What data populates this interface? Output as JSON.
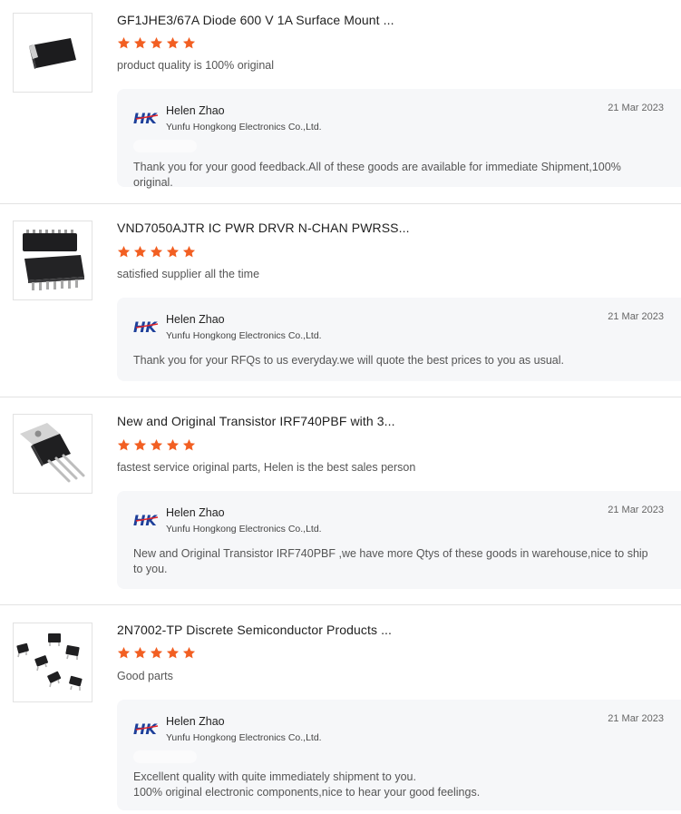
{
  "reviews": [
    {
      "product": "GF1JHE3/67A Diode 600 V 1A Surface Mount ...",
      "rating": 5,
      "comment": "product quality is 100% original",
      "thumbnail_icon": "smd-diode-icon",
      "reply": {
        "name": "Helen Zhao",
        "company": "Yunfu Hongkong Electronics Co.,Ltd.",
        "date": "21 Mar 2023",
        "text": "Thank you for your good feedback.All of these goods are available for immediate Shipment,100% original."
      }
    },
    {
      "product": "VND7050AJTR IC PWR DRVR N-CHAN PWRSS...",
      "rating": 5,
      "comment": "satisfied supplier all the time",
      "thumbnail_icon": "power-ic-icon",
      "reply": {
        "name": "Helen Zhao",
        "company": "Yunfu Hongkong Electronics Co.,Ltd.",
        "date": "21 Mar 2023",
        "text": "Thank you for your RFQs to us everyday.we will quote the best prices to you as usual."
      }
    },
    {
      "product": "New and Original Transistor IRF740PBF with 3...",
      "rating": 5,
      "comment": "fastest service original parts, Helen is the best sales person",
      "thumbnail_icon": "to220-transistor-icon",
      "reply": {
        "name": "Helen Zhao",
        "company": "Yunfu Hongkong Electronics Co.,Ltd.",
        "date": "21 Mar 2023",
        "text": "New and Original Transistor IRF740PBF ,we have more Qtys of these goods in warehouse,nice to ship to you."
      }
    },
    {
      "product": "2N7002-TP Discrete Semiconductor Products ...",
      "rating": 5,
      "comment": "Good parts",
      "thumbnail_icon": "sot23-transistors-icon",
      "reply": {
        "name": "Helen Zhao",
        "company": "Yunfu Hongkong Electronics Co.,Ltd.",
        "date": "21 Mar 2023",
        "text_line1": "Excellent quality with quite immediately shipment to you.",
        "text_line2": "100% original electronic components,nice to hear your good feelings."
      }
    }
  ],
  "colors": {
    "star": "#f25f22",
    "logo_blue": "#1d3f9a",
    "logo_red": "#e0242a",
    "reply_bg": "#f6f7f9"
  }
}
